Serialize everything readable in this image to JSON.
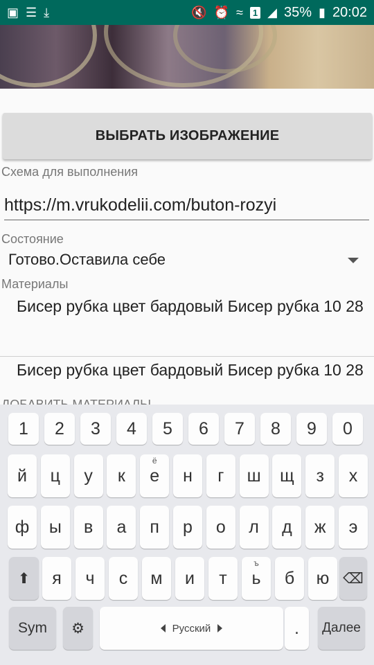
{
  "status_bar": {
    "left_icons": [
      "image-icon",
      "list-icon",
      "download-icon"
    ],
    "right_icons": [
      "mute-icon",
      "alarm-icon",
      "wifi-icon"
    ],
    "sim": "1",
    "battery": "35%",
    "time": "20:02"
  },
  "button": {
    "label": "ВЫБРАТЬ ИЗОБРАЖЕНИЕ"
  },
  "scheme": {
    "label": "Схема для выполнения",
    "value": "https://m.vrukodelii.com/buton-rozyi"
  },
  "state": {
    "label": "Состояние",
    "value": "Готово.Оставила себе"
  },
  "materials": {
    "label": "Материалы",
    "items": [
      "Бисер рубка цвет бардовый Бисер рубка 10 28",
      "Бисер рубка цвет бардовый Бисер рубка 10 28"
    ],
    "add_label": "Добавить материалы"
  },
  "keyboard": {
    "row_digits": [
      "1",
      "2",
      "3",
      "4",
      "5",
      "6",
      "7",
      "8",
      "9",
      "0"
    ],
    "row1": [
      "й",
      "ц",
      "у",
      "к",
      "е",
      "н",
      "г",
      "ш",
      "щ",
      "з",
      "х"
    ],
    "row1_hint_e": "ё",
    "row2": [
      "ф",
      "ы",
      "в",
      "а",
      "п",
      "р",
      "о",
      "л",
      "д",
      "ж",
      "э"
    ],
    "row3": [
      "я",
      "ч",
      "с",
      "м",
      "и",
      "т",
      "ь",
      "б",
      "ю"
    ],
    "row3_hint_soft": "ъ",
    "sym": "Sym",
    "language": "Русский",
    "period": ".",
    "done": "Далее"
  }
}
